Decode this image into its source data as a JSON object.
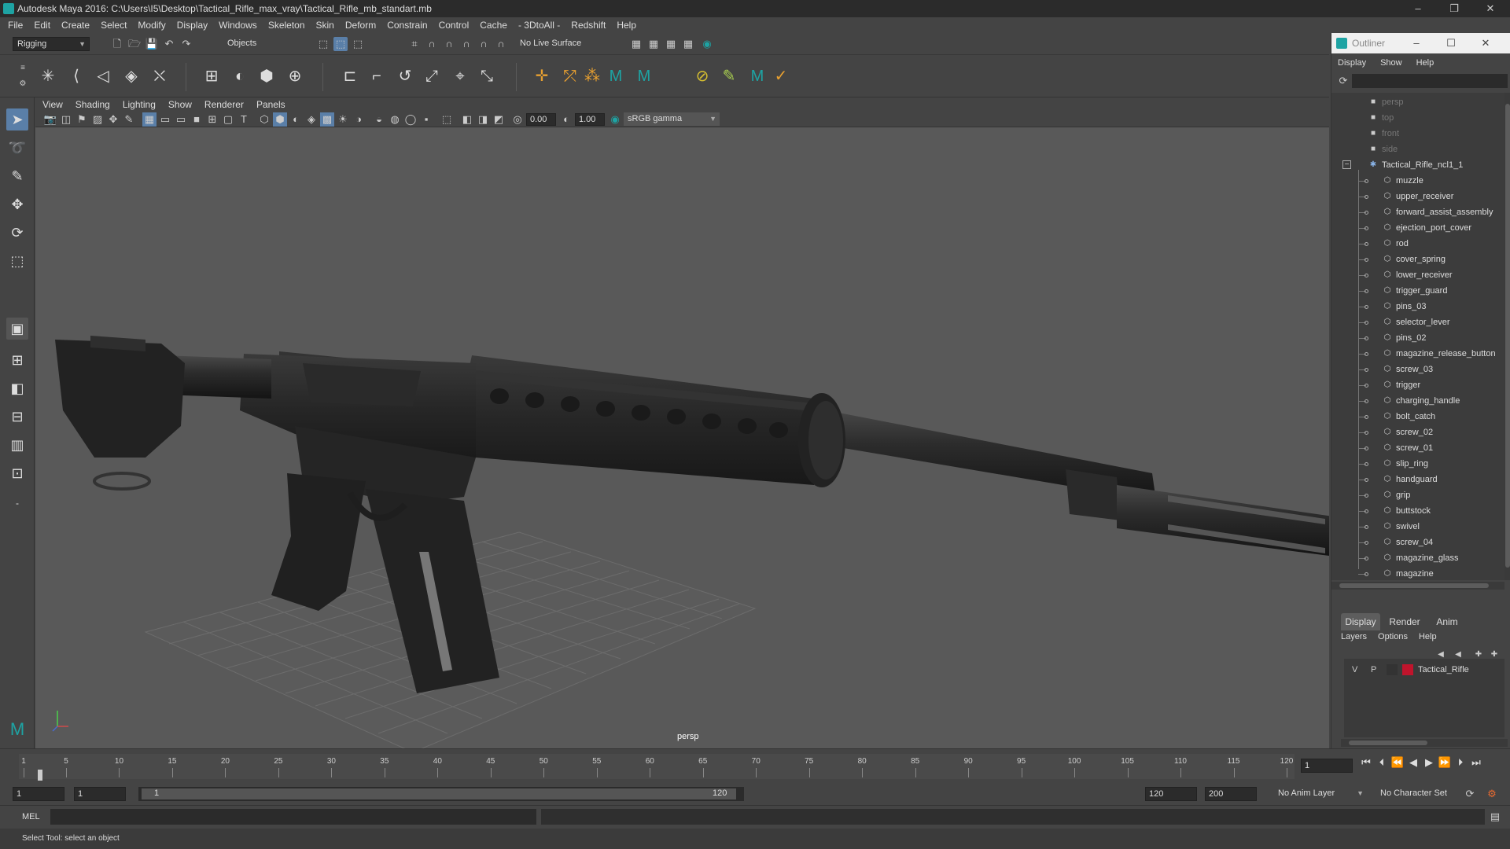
{
  "window": {
    "title": "Autodesk Maya 2016: C:\\Users\\I5\\Desktop\\Tactical_Rifle_max_vray\\Tactical_Rifle_mb_standart.mb",
    "minimize": "–",
    "maximize": "❐",
    "close": "✕"
  },
  "menubar": [
    "File",
    "Edit",
    "Create",
    "Select",
    "Modify",
    "Display",
    "Windows",
    "Skeleton",
    "Skin",
    "Deform",
    "Constrain",
    "Control",
    "Cache",
    "- 3DtoAll -",
    "Redshift",
    "Help"
  ],
  "toolbar": {
    "mode": "Rigging",
    "selection_mask": "Objects",
    "live_surface": "No Live Surface"
  },
  "panel": {
    "menu": [
      "View",
      "Shading",
      "Lighting",
      "Show",
      "Renderer",
      "Panels"
    ],
    "field_a": "0.00",
    "field_b": "1.00",
    "color_space": "sRGB gamma",
    "camera_label": "persp"
  },
  "outliner": {
    "title": "Outliner",
    "menu": [
      "Display",
      "Show",
      "Help"
    ],
    "cameras": [
      "persp",
      "top",
      "front",
      "side"
    ],
    "group": "Tactical_Rifle_ncl1_1",
    "children": [
      "muzzle",
      "upper_receiver",
      "forward_assist_assembly",
      "ejection_port_cover",
      "rod",
      "cover_spring",
      "lower_receiver",
      "trigger_guard",
      "pins_03",
      "selector_lever",
      "pins_02",
      "magazine_release_button",
      "screw_03",
      "trigger",
      "charging_handle",
      "bolt_catch",
      "screw_02",
      "screw_01",
      "slip_ring",
      "handguard",
      "grip",
      "buttstock",
      "swivel",
      "screw_04",
      "magazine_glass",
      "magazine"
    ]
  },
  "layers": {
    "tabs": [
      "Display",
      "Render",
      "Anim"
    ],
    "menu": [
      "Layers",
      "Options",
      "Help"
    ],
    "layer": {
      "v": "V",
      "p": "P",
      "name": "Tactical_Rifle",
      "color": "#c0142c"
    }
  },
  "timeline": {
    "ticks": [
      "1",
      "5",
      "10",
      "15",
      "20",
      "25",
      "30",
      "35",
      "40",
      "45",
      "50",
      "55",
      "60",
      "65",
      "70",
      "75",
      "80",
      "85",
      "90",
      "95",
      "100",
      "105",
      "110",
      "115",
      "120"
    ],
    "current_frame": "1"
  },
  "range": {
    "start": "1",
    "playback_start": "1",
    "slider_start": "1",
    "slider_end": "120",
    "playback_end": "120",
    "end": "200",
    "anim_layer": "No Anim Layer",
    "character_set": "No Character Set"
  },
  "mel": {
    "label": "MEL"
  },
  "status": {
    "text": "Select Tool: select an object"
  },
  "colors": {
    "maya_teal": "#1ea3a3",
    "viewport_bg": "#595959",
    "panel_bg": "#444444"
  }
}
